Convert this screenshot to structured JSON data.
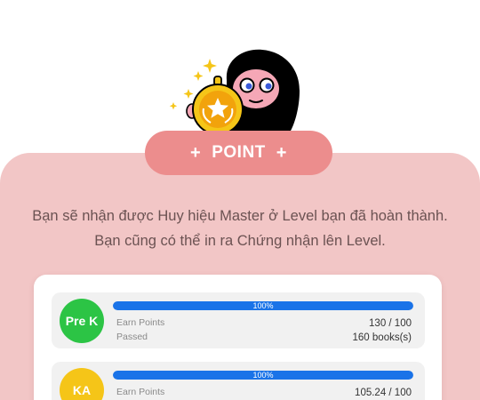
{
  "header": {
    "title": "POINT",
    "plus_left": "+",
    "plus_right": "+"
  },
  "description": {
    "line1": "Bạn sẽ nhận được Huy hiệu Master ở Level bạn đã hoàn thành.",
    "line2": "Bạn cũng có thể in ra Chứng nhận lên Level."
  },
  "levels": [
    {
      "badge": "Pre K",
      "badge_color": "#2cc445",
      "progress_percent": 100,
      "progress_label": "100%",
      "earn_label": "Earn Points",
      "earn_value": "130 / 100",
      "passed_label": "Passed",
      "passed_value": "160 books(s)"
    },
    {
      "badge": "KA",
      "badge_color": "#f5c518",
      "progress_percent": 100,
      "progress_label": "100%",
      "earn_label": "Earn Points",
      "earn_value": "105.24 / 100"
    }
  ],
  "colors": {
    "panel": "#f2c6c6",
    "pill": "#ec8d8d",
    "progress": "#1a73e8",
    "medal": "#f5c518"
  }
}
